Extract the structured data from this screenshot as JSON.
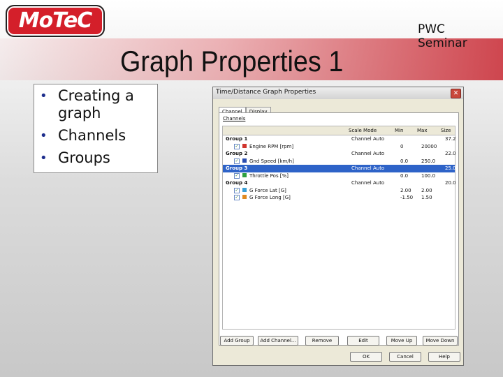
{
  "header": {
    "logo_text": "MoTeC",
    "slide_title": "Graph Properties 1",
    "seminar": [
      "PWC",
      "Seminar"
    ],
    "colors": {
      "logo_red": "#d41f2a",
      "band_red": "#c82832",
      "bullet_blue": "#1c2d8c"
    }
  },
  "bullets": [
    "Creating a graph",
    "Channels",
    "Groups"
  ],
  "dialog": {
    "title": "Time/Distance Graph Properties",
    "close_glyph": "✕",
    "tabs": [
      "Channel",
      "Display"
    ],
    "section_label": "Channels",
    "columns": [
      "Scale Mode",
      "Min",
      "Max",
      "Size"
    ],
    "rows": [
      {
        "type": "group",
        "name": "Group 1",
        "scale": "Channel Auto",
        "min": "",
        "max": "",
        "size": "37.2"
      },
      {
        "type": "channel",
        "name": "Engine RPM [rpm]",
        "color": "#d0342c",
        "scale": "",
        "min": "0",
        "max": "20000",
        "size": ""
      },
      {
        "type": "group",
        "name": "Group 2",
        "scale": "Channel Auto",
        "min": "",
        "max": "",
        "size": "22.0"
      },
      {
        "type": "channel",
        "name": "Gnd Speed [km/h]",
        "color": "#2a4db0",
        "scale": "",
        "min": "0.0",
        "max": "250.0",
        "size": ""
      },
      {
        "type": "group",
        "name": "Group 3",
        "scale": "Channel Auto",
        "min": "",
        "max": "",
        "size": "25.0",
        "selected": true
      },
      {
        "type": "channel",
        "name": "Throttle Pos [%]",
        "color": "#2fa040",
        "scale": "",
        "min": "0.0",
        "max": "100.0",
        "size": ""
      },
      {
        "type": "group",
        "name": "Group 4",
        "scale": "Channel Auto",
        "min": "",
        "max": "",
        "size": "20.0"
      },
      {
        "type": "channel",
        "name": "G Force Lat [G]",
        "color": "#3aa0d8",
        "scale": "",
        "min": "2.00",
        "max": "2.00",
        "size": ""
      },
      {
        "type": "channel",
        "name": "G Force Long [G]",
        "color": "#e08a20",
        "scale": "",
        "min": "-1.50",
        "max": "1.50",
        "size": ""
      }
    ],
    "buttons": [
      "Add Group",
      "Add Channel...",
      "Remove",
      "Edit",
      "Move Up",
      "Move Down"
    ],
    "footer_buttons": [
      "OK",
      "Cancel",
      "Help"
    ],
    "check_glyph": "✓"
  }
}
